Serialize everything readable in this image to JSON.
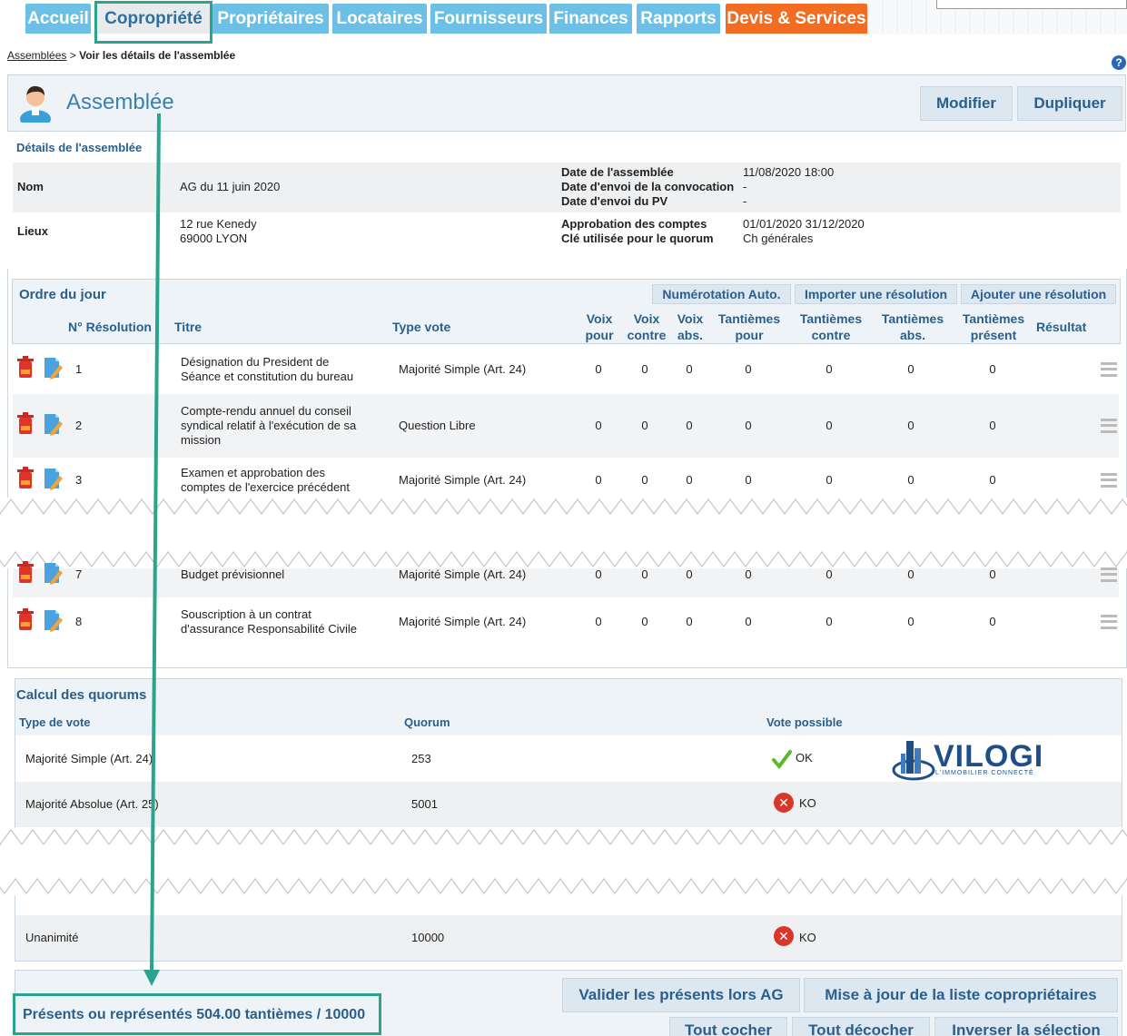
{
  "nav": {
    "tabs": [
      "Accueil",
      "Copropriété",
      "Propriétaires",
      "Locataires",
      "Fournisseurs",
      "Finances",
      "Rapports",
      "Devis & Services"
    ],
    "active": "Copropriété"
  },
  "breadcrumb": {
    "link": "Assemblées",
    "sep": ">",
    "current": "Voir les détails de l'assemblée"
  },
  "header": {
    "title": "Assemblée",
    "edit_label": "Modifier",
    "duplicate_label": "Dupliquer"
  },
  "details": {
    "section_title": "Détails de l'assemblée",
    "name_label": "Nom",
    "name_value": "AG du 11 juin 2020",
    "place_label": "Lieux",
    "place_line1": "12 rue Kenedy",
    "place_line2": "69000 LYON",
    "date_label": "Date de l'assemblée",
    "date_value": "11/08/2020 18:00",
    "convocation_label": "Date d'envoi de la convocation",
    "convocation_value": "-",
    "pv_label": "Date d'envoi du PV",
    "pv_value": "-",
    "approval_label": "Approbation des comptes",
    "approval_value": "01/01/2020 31/12/2020",
    "key_label": "Clé utilisée pour le quorum",
    "key_value": "Ch générales"
  },
  "agenda": {
    "title": "Ordre du jour",
    "actions": [
      "Numérotation Auto.",
      "Importer une résolution",
      "Ajouter une résolution"
    ],
    "columns": {
      "num": "N° Résolution",
      "title": "Titre",
      "type": "Type vote",
      "voix_pour": [
        "Voix",
        "pour"
      ],
      "voix_contre": [
        "Voix",
        "contre"
      ],
      "voix_abs": [
        "Voix",
        "abs."
      ],
      "t_pour": [
        "Tantièmes",
        "pour"
      ],
      "t_contre": [
        "Tantièmes",
        "contre"
      ],
      "t_abs": [
        "Tantièmes",
        "abs."
      ],
      "t_present": [
        "Tantièmes",
        "présent"
      ],
      "result": "Résultat"
    },
    "rows": [
      {
        "num": "1",
        "title": [
          "Désignation du President de",
          "Séance et constitution du bureau"
        ],
        "type": "Majorité Simple (Art. 24)",
        "v": [
          "0",
          "0",
          "0",
          "0",
          "0",
          "0",
          "0"
        ]
      },
      {
        "num": "2",
        "title": [
          "Compte-rendu annuel du conseil",
          "syndical relatif à l'exécution de sa",
          "mission"
        ],
        "type": "Question Libre",
        "v": [
          "0",
          "0",
          "0",
          "0",
          "0",
          "0",
          "0"
        ]
      },
      {
        "num": "3",
        "title": [
          "Examen et approbation des",
          "comptes de l'exercice précédent"
        ],
        "type": "Majorité Simple (Art. 24)",
        "v": [
          "0",
          "0",
          "0",
          "0",
          "0",
          "0",
          "0"
        ]
      },
      {
        "num": "7",
        "title": [
          "Budget prévisionnel"
        ],
        "type": "Majorité Simple (Art. 24)",
        "v": [
          "0",
          "0",
          "0",
          "0",
          "0",
          "0",
          "0"
        ]
      },
      {
        "num": "8",
        "title": [
          "Souscription à un contrat",
          "d'assurance Responsabilité Civile"
        ],
        "type": "Majorité Simple (Art. 24)",
        "v": [
          "0",
          "0",
          "0",
          "0",
          "0",
          "0",
          "0"
        ]
      }
    ]
  },
  "quorum": {
    "title": "Calcul des quorums",
    "col_type": "Type de vote",
    "col_quorum": "Quorum",
    "col_possible": "Vote possible",
    "rows": [
      {
        "type": "Majorité Simple (Art. 24)",
        "quorum": "253",
        "status": "OK"
      },
      {
        "type": "Majorité Absolue (Art. 25)",
        "quorum": "5001",
        "status": "KO"
      },
      {
        "type": "Unanimité",
        "quorum": "10000",
        "status": "KO"
      }
    ],
    "logo_name": "VILOGI",
    "logo_tagline": "L'IMMOBILIER CONNECTÉ"
  },
  "footer": {
    "presents": "Présents ou représentés 504.00 tantièmes / 10000",
    "validate_label": "Valider les présents lors AG",
    "update_label": "Mise à jour de la liste copropriétaires",
    "check_all": "Tout cocher",
    "uncheck_all": "Tout décocher",
    "invert": "Inverser la sélection"
  },
  "colors": {
    "tab": "#6cc0e5",
    "tab_orange": "#f26d22",
    "accent": "#2a5f8c",
    "highlight": "#2aa48a",
    "ko": "#d9372b",
    "ok": "#5cb82e"
  }
}
